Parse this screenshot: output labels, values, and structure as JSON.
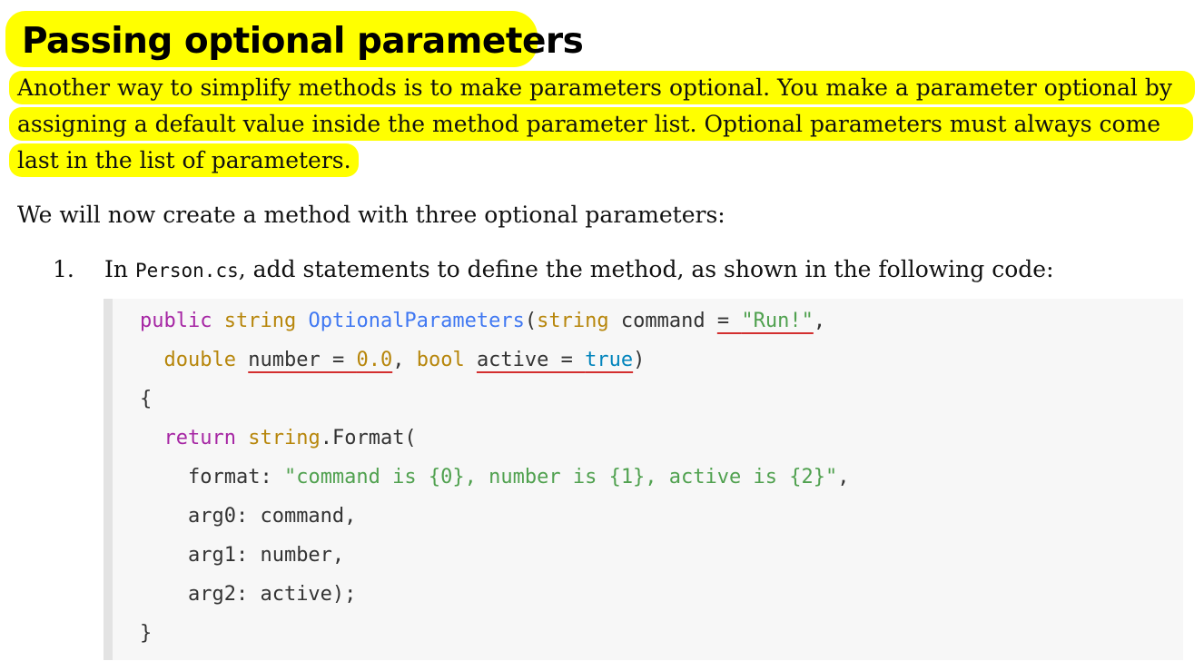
{
  "heading": "Passing optional parameters",
  "intro_lines": [
    "Another way to simplify methods is to make parameters optional. You make a parameter optional by",
    "assigning a default value inside the method parameter list. Optional parameters must always come",
    "last in the list of parameters."
  ],
  "paragraph": "We will now create a method with three optional parameters:",
  "step": {
    "number": "1.",
    "prefix": "In ",
    "file": "Person.cs",
    "suffix": ", add statements to define the method, as shown in the following code:"
  },
  "code": {
    "l1": {
      "kw_public": "public",
      "ty_string": "string",
      "fn_name": "OptionalParameters",
      "paren_open": "(",
      "ty_string2": "string",
      "sp_command": " command ",
      "default1": "= \"Run!\"",
      "comma": ","
    },
    "l2": {
      "ty_double": "double",
      "number_default": "number = 0.0",
      "comma": ",",
      "ty_bool": "bool",
      "active_default": "active = true",
      "paren_close": ")"
    },
    "l3": "{",
    "l4": {
      "kw_return": "return",
      "ty_string": "string",
      "rest": ".Format("
    },
    "l5": {
      "label": "format: ",
      "str": "\"command is {0}, number is {1}, active is {2}\"",
      "comma": ","
    },
    "l6": "arg0: command,",
    "l7": "arg1: number,",
    "l8": "arg2: active);",
    "l9": "}"
  },
  "colors": {
    "highlight": "#ffff00",
    "keyword": "#a626a4",
    "type": "#b7860b",
    "function": "#4078f2",
    "string": "#50a14f",
    "boolean": "#0184bc",
    "squiggle": "#d32f2f"
  }
}
